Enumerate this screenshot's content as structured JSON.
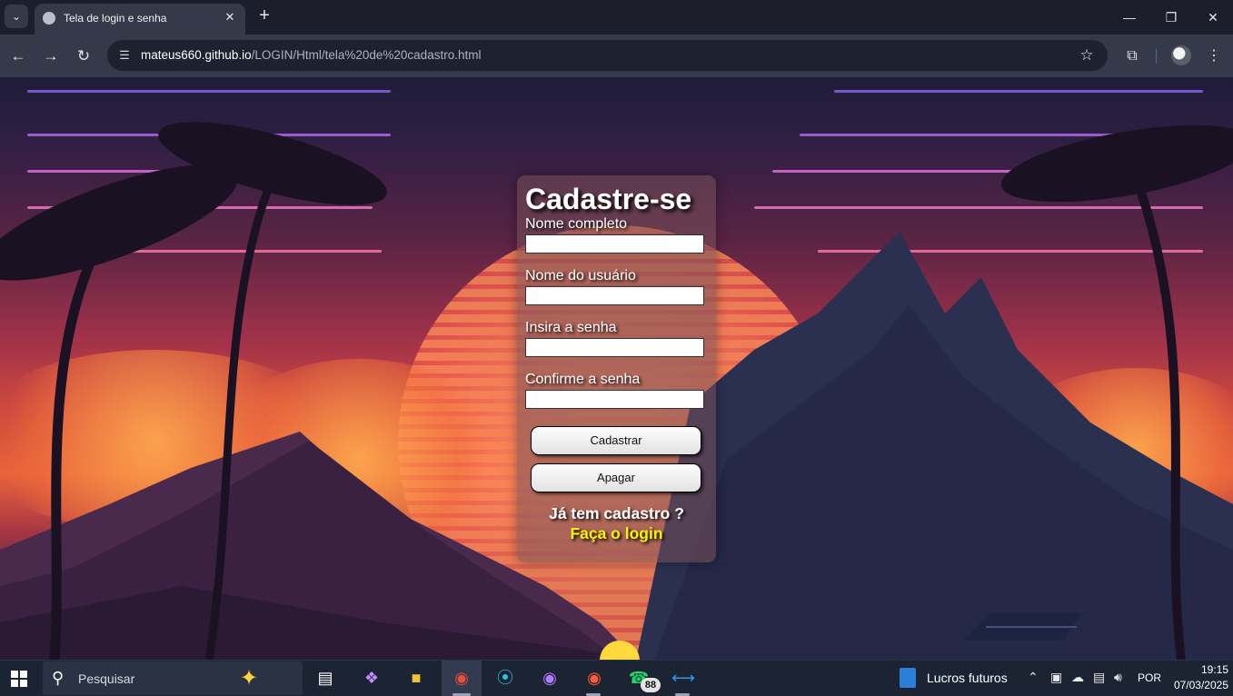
{
  "browser": {
    "tab_title": "Tela de login e senha",
    "url_host": "mateus660.github.io",
    "url_path": "/LOGIN/Html/tela%20de%20cadastro.html"
  },
  "form": {
    "title": "Cadastre-se",
    "fields": [
      {
        "label": "Nome completo",
        "value": ""
      },
      {
        "label": "Nome do usuário",
        "value": ""
      },
      {
        "label": "Insira a senha",
        "value": ""
      },
      {
        "label": "Confirme a senha",
        "value": ""
      }
    ],
    "submit_label": "Cadastrar",
    "clear_label": "Apagar",
    "has_account_text": "Já tem cadastro ?",
    "login_link": "Faça o login"
  },
  "taskbar": {
    "search_placeholder": "Pesquisar",
    "whatsapp_badge": "88",
    "widget_text": "Lucros futuros",
    "language": "POR",
    "time": "19:15",
    "date": "07/03/2025"
  },
  "colors": {
    "link": "#f5f500",
    "sky_top": "#1d1d38",
    "sunset": "#e9643a"
  }
}
